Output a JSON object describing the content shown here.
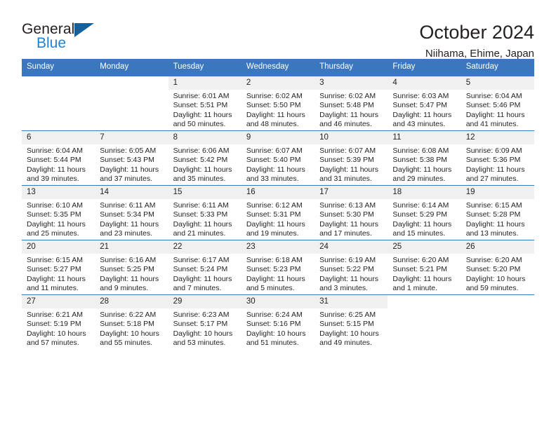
{
  "brand": {
    "name_part1": "General",
    "name_part2": "Blue",
    "accent_color": "#1d82d4",
    "triangle_color": "#14619f"
  },
  "header": {
    "title": "October 2024",
    "subtitle": "Niihama, Ehime, Japan",
    "header_bg_color": "#3a77be"
  },
  "calendar": {
    "weekday_headers": [
      "Sunday",
      "Monday",
      "Tuesday",
      "Wednesday",
      "Thursday",
      "Friday",
      "Saturday"
    ],
    "labels": {
      "sunrise": "Sunrise:",
      "sunset": "Sunset:",
      "daylight": "Daylight:"
    },
    "weeks": [
      [
        {
          "day": "",
          "sunrise": "",
          "sunset": "",
          "daylight": ""
        },
        {
          "day": "",
          "sunrise": "",
          "sunset": "",
          "daylight": ""
        },
        {
          "day": "1",
          "sunrise": "Sunrise: 6:01 AM",
          "sunset": "Sunset: 5:51 PM",
          "daylight": "Daylight: 11 hours and 50 minutes."
        },
        {
          "day": "2",
          "sunrise": "Sunrise: 6:02 AM",
          "sunset": "Sunset: 5:50 PM",
          "daylight": "Daylight: 11 hours and 48 minutes."
        },
        {
          "day": "3",
          "sunrise": "Sunrise: 6:02 AM",
          "sunset": "Sunset: 5:48 PM",
          "daylight": "Daylight: 11 hours and 46 minutes."
        },
        {
          "day": "4",
          "sunrise": "Sunrise: 6:03 AM",
          "sunset": "Sunset: 5:47 PM",
          "daylight": "Daylight: 11 hours and 43 minutes."
        },
        {
          "day": "5",
          "sunrise": "Sunrise: 6:04 AM",
          "sunset": "Sunset: 5:46 PM",
          "daylight": "Daylight: 11 hours and 41 minutes."
        }
      ],
      [
        {
          "day": "6",
          "sunrise": "Sunrise: 6:04 AM",
          "sunset": "Sunset: 5:44 PM",
          "daylight": "Daylight: 11 hours and 39 minutes."
        },
        {
          "day": "7",
          "sunrise": "Sunrise: 6:05 AM",
          "sunset": "Sunset: 5:43 PM",
          "daylight": "Daylight: 11 hours and 37 minutes."
        },
        {
          "day": "8",
          "sunrise": "Sunrise: 6:06 AM",
          "sunset": "Sunset: 5:42 PM",
          "daylight": "Daylight: 11 hours and 35 minutes."
        },
        {
          "day": "9",
          "sunrise": "Sunrise: 6:07 AM",
          "sunset": "Sunset: 5:40 PM",
          "daylight": "Daylight: 11 hours and 33 minutes."
        },
        {
          "day": "10",
          "sunrise": "Sunrise: 6:07 AM",
          "sunset": "Sunset: 5:39 PM",
          "daylight": "Daylight: 11 hours and 31 minutes."
        },
        {
          "day": "11",
          "sunrise": "Sunrise: 6:08 AM",
          "sunset": "Sunset: 5:38 PM",
          "daylight": "Daylight: 11 hours and 29 minutes."
        },
        {
          "day": "12",
          "sunrise": "Sunrise: 6:09 AM",
          "sunset": "Sunset: 5:36 PM",
          "daylight": "Daylight: 11 hours and 27 minutes."
        }
      ],
      [
        {
          "day": "13",
          "sunrise": "Sunrise: 6:10 AM",
          "sunset": "Sunset: 5:35 PM",
          "daylight": "Daylight: 11 hours and 25 minutes."
        },
        {
          "day": "14",
          "sunrise": "Sunrise: 6:11 AM",
          "sunset": "Sunset: 5:34 PM",
          "daylight": "Daylight: 11 hours and 23 minutes."
        },
        {
          "day": "15",
          "sunrise": "Sunrise: 6:11 AM",
          "sunset": "Sunset: 5:33 PM",
          "daylight": "Daylight: 11 hours and 21 minutes."
        },
        {
          "day": "16",
          "sunrise": "Sunrise: 6:12 AM",
          "sunset": "Sunset: 5:31 PM",
          "daylight": "Daylight: 11 hours and 19 minutes."
        },
        {
          "day": "17",
          "sunrise": "Sunrise: 6:13 AM",
          "sunset": "Sunset: 5:30 PM",
          "daylight": "Daylight: 11 hours and 17 minutes."
        },
        {
          "day": "18",
          "sunrise": "Sunrise: 6:14 AM",
          "sunset": "Sunset: 5:29 PM",
          "daylight": "Daylight: 11 hours and 15 minutes."
        },
        {
          "day": "19",
          "sunrise": "Sunrise: 6:15 AM",
          "sunset": "Sunset: 5:28 PM",
          "daylight": "Daylight: 11 hours and 13 minutes."
        }
      ],
      [
        {
          "day": "20",
          "sunrise": "Sunrise: 6:15 AM",
          "sunset": "Sunset: 5:27 PM",
          "daylight": "Daylight: 11 hours and 11 minutes."
        },
        {
          "day": "21",
          "sunrise": "Sunrise: 6:16 AM",
          "sunset": "Sunset: 5:25 PM",
          "daylight": "Daylight: 11 hours and 9 minutes."
        },
        {
          "day": "22",
          "sunrise": "Sunrise: 6:17 AM",
          "sunset": "Sunset: 5:24 PM",
          "daylight": "Daylight: 11 hours and 7 minutes."
        },
        {
          "day": "23",
          "sunrise": "Sunrise: 6:18 AM",
          "sunset": "Sunset: 5:23 PM",
          "daylight": "Daylight: 11 hours and 5 minutes."
        },
        {
          "day": "24",
          "sunrise": "Sunrise: 6:19 AM",
          "sunset": "Sunset: 5:22 PM",
          "daylight": "Daylight: 11 hours and 3 minutes."
        },
        {
          "day": "25",
          "sunrise": "Sunrise: 6:20 AM",
          "sunset": "Sunset: 5:21 PM",
          "daylight": "Daylight: 11 hours and 1 minute."
        },
        {
          "day": "26",
          "sunrise": "Sunrise: 6:20 AM",
          "sunset": "Sunset: 5:20 PM",
          "daylight": "Daylight: 10 hours and 59 minutes."
        }
      ],
      [
        {
          "day": "27",
          "sunrise": "Sunrise: 6:21 AM",
          "sunset": "Sunset: 5:19 PM",
          "daylight": "Daylight: 10 hours and 57 minutes."
        },
        {
          "day": "28",
          "sunrise": "Sunrise: 6:22 AM",
          "sunset": "Sunset: 5:18 PM",
          "daylight": "Daylight: 10 hours and 55 minutes."
        },
        {
          "day": "29",
          "sunrise": "Sunrise: 6:23 AM",
          "sunset": "Sunset: 5:17 PM",
          "daylight": "Daylight: 10 hours and 53 minutes."
        },
        {
          "day": "30",
          "sunrise": "Sunrise: 6:24 AM",
          "sunset": "Sunset: 5:16 PM",
          "daylight": "Daylight: 10 hours and 51 minutes."
        },
        {
          "day": "31",
          "sunrise": "Sunrise: 6:25 AM",
          "sunset": "Sunset: 5:15 PM",
          "daylight": "Daylight: 10 hours and 49 minutes."
        },
        {
          "day": "",
          "sunrise": "",
          "sunset": "",
          "daylight": ""
        },
        {
          "day": "",
          "sunrise": "",
          "sunset": "",
          "daylight": ""
        }
      ]
    ]
  }
}
